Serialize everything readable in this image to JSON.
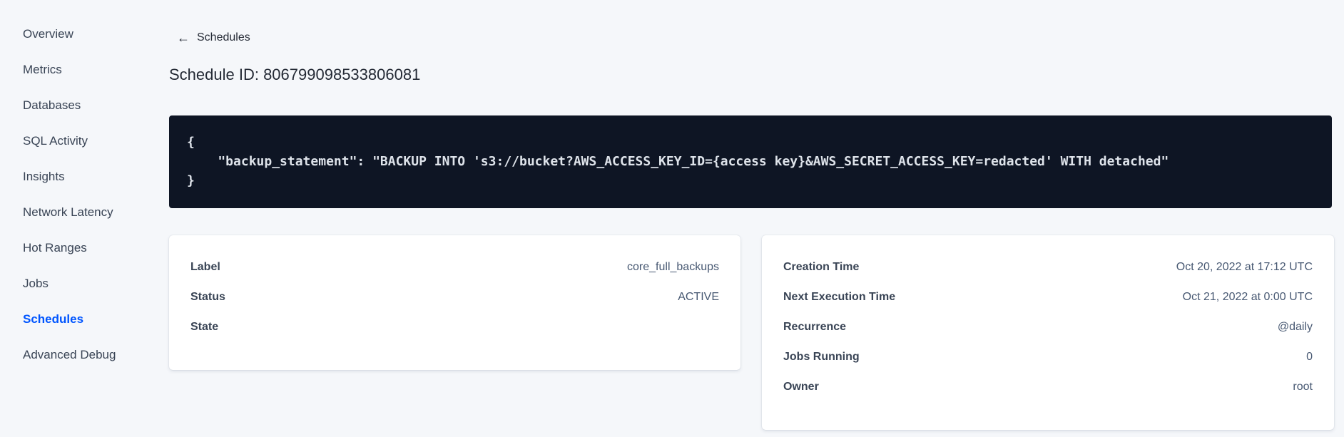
{
  "sidebar": {
    "items": [
      {
        "label": "Overview"
      },
      {
        "label": "Metrics"
      },
      {
        "label": "Databases"
      },
      {
        "label": "SQL Activity"
      },
      {
        "label": "Insights"
      },
      {
        "label": "Network Latency"
      },
      {
        "label": "Hot Ranges"
      },
      {
        "label": "Jobs"
      },
      {
        "label": "Schedules",
        "active": true
      },
      {
        "label": "Advanced Debug"
      }
    ]
  },
  "header": {
    "back_arrow": "←",
    "back_link": "Schedules",
    "title": "Schedule ID: 806799098533806081"
  },
  "code_block": {
    "lines": [
      "{",
      "    \"backup_statement\": \"BACKUP INTO 's3://bucket?AWS_ACCESS_KEY_ID={access key}&AWS_SECRET_ACCESS_KEY=redacted' WITH detached\"",
      "}"
    ]
  },
  "left_card": {
    "rows": [
      {
        "label": "Label",
        "value": "core_full_backups"
      },
      {
        "label": "Status",
        "value": "ACTIVE"
      },
      {
        "label": "State",
        "value": ""
      }
    ]
  },
  "right_card": {
    "rows": [
      {
        "label": "Creation Time",
        "value": "Oct 20, 2022 at 17:12 UTC"
      },
      {
        "label": "Next Execution Time",
        "value": "Oct 21, 2022 at 0:00 UTC"
      },
      {
        "label": "Recurrence",
        "value": "@daily"
      },
      {
        "label": "Jobs Running",
        "value": "0"
      },
      {
        "label": "Owner",
        "value": "root"
      }
    ]
  },
  "colors": {
    "background": "#f5f7fa",
    "accent_blue": "#0055ff",
    "code_background": "#0e1524",
    "code_text": "#dee3ea",
    "heading_text": "#242a35",
    "label_text": "#394455",
    "value_text": "#475872",
    "card_background": "#ffffff"
  }
}
